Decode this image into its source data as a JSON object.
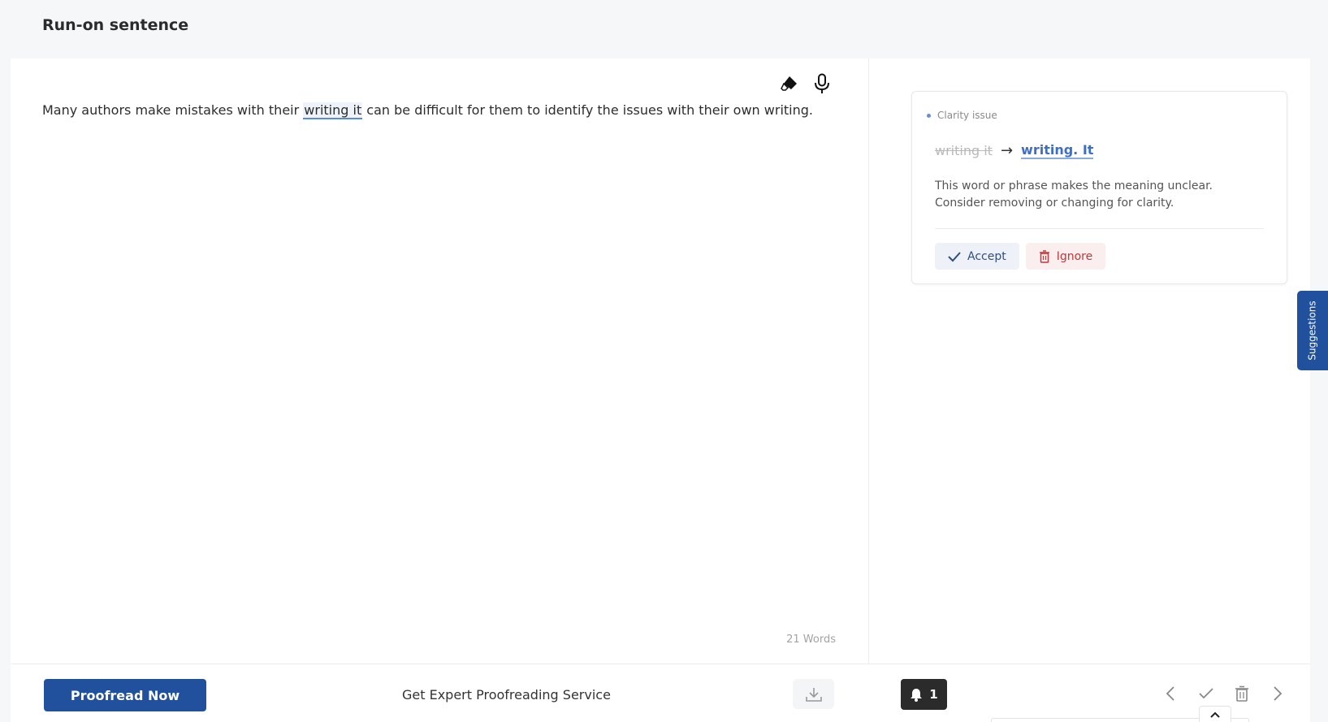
{
  "page": {
    "title": "Run-on sentence"
  },
  "editor": {
    "text_before": "Many authors make mistakes with their ",
    "text_highlight": "writing it",
    "text_after": " can be difficult for them to identify the issues with their own writing.",
    "word_count": "21 Words",
    "tools": [
      "eraser-icon",
      "microphone-icon"
    ]
  },
  "suggestion": {
    "issue_type": "Clarity issue",
    "original": "writing it",
    "arrow": "→",
    "replacement": "writing. It",
    "explanation": "This word or phrase makes the meaning unclear. Consider removing or changing for clarity.",
    "accept_label": "Accept",
    "ignore_label": "Ignore"
  },
  "sidebar_tab": {
    "label": "Suggestions"
  },
  "footer": {
    "proofread_label": "Proofread Now",
    "expert_label": "Get Expert Proofreading Service",
    "notification_count": "1"
  },
  "colors": {
    "primary": "#21519c",
    "highlight_underline": "#5b8ad6",
    "ignore_text": "#c0393b"
  }
}
